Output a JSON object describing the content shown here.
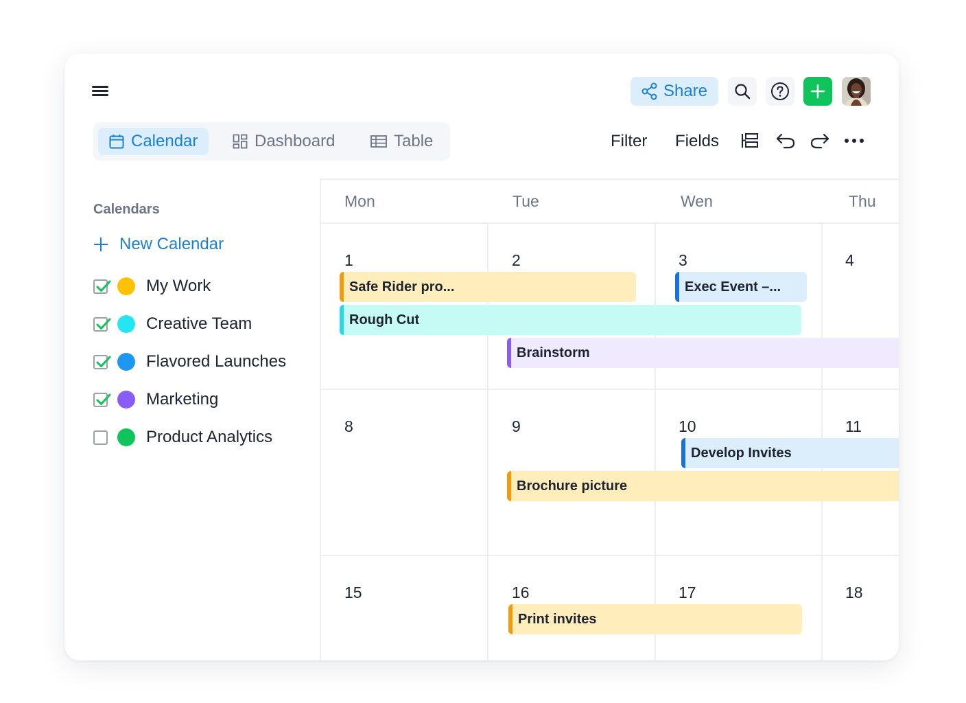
{
  "header": {
    "share_label": "Share"
  },
  "tabs": [
    {
      "label": "Calendar",
      "active": true
    },
    {
      "label": "Dashboard",
      "active": false
    },
    {
      "label": "Table",
      "active": false
    }
  ],
  "toolbar": {
    "filter_label": "Filter",
    "fields_label": "Fields"
  },
  "sidebar": {
    "heading": "Calendars",
    "new_calendar_label": "New Calendar",
    "calendars": [
      {
        "label": "My Work",
        "checked": true,
        "color": "#ffc107"
      },
      {
        "label": "Creative Team",
        "checked": true,
        "color": "#24e5f2"
      },
      {
        "label": "Flavored Launches",
        "checked": true,
        "color": "#1e97f3"
      },
      {
        "label": "Marketing",
        "checked": true,
        "color": "#8a5cf6"
      },
      {
        "label": "Product Analytics",
        "checked": false,
        "color": "#10c45c"
      }
    ]
  },
  "calendar": {
    "days": [
      "Mon",
      "Tue",
      "Wen",
      "Thu"
    ],
    "weeks": [
      [
        "1",
        "2",
        "3",
        "4"
      ],
      [
        "8",
        "9",
        "10",
        "11"
      ],
      [
        "15",
        "16",
        "17",
        "18"
      ]
    ],
    "events": {
      "safe_rider": "Safe Rider pro...",
      "exec_event": "Exec Event –...",
      "rough_cut": "Rough Cut",
      "brainstorm": "Brainstorm",
      "develop_invites": "Develop Invites",
      "brochure_picture": "Brochure picture",
      "print_invites": "Print invites"
    }
  },
  "colors": {
    "accent_blue": "#1a7fd8",
    "add_green": "#10c45c",
    "event_orange_bg": "#ffedbc",
    "event_orange_bar": "#f59a0b",
    "event_cyan_bg": "#c6faf4",
    "event_cyan_bar": "#28d8ea",
    "event_blue_bg": "#dcedfc",
    "event_blue_bar": "#1a73d4",
    "event_purple_bg": "#efeafd",
    "event_purple_bar": "#8a5cf6"
  }
}
